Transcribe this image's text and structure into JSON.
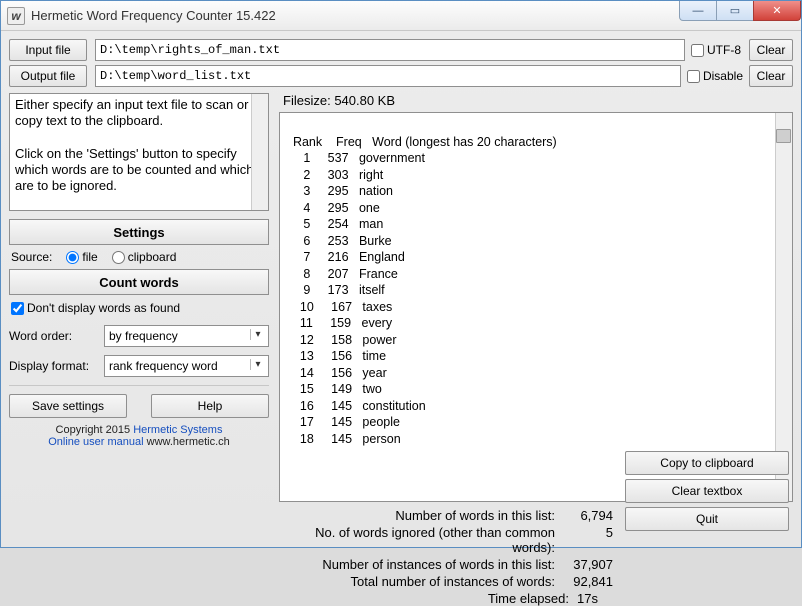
{
  "window": {
    "title": "Hermetic Word Frequency Counter 15.422"
  },
  "io": {
    "input_btn": "Input file",
    "output_btn": "Output file",
    "input_path": "D:\\temp\\rights_of_man.txt",
    "output_path": "D:\\temp\\word_list.txt",
    "utf8_label": "UTF-8",
    "disable_label": "Disable",
    "clear_label": "Clear"
  },
  "info": {
    "text1": "Either specify an input text file to scan or copy text to the clipboard.",
    "text2": "Click on the 'Settings' button to specify which words are to be counted and which are to be ignored."
  },
  "left": {
    "settings_btn": "Settings",
    "source_label": "Source:",
    "source_file": "file",
    "source_clip": "clipboard",
    "count_btn": "Count words",
    "dont_display": "Don't display words as found",
    "word_order_label": "Word order:",
    "word_order_value": "by frequency",
    "display_format_label": "Display format:",
    "display_format_value": "rank frequency word",
    "save_settings": "Save settings",
    "help": "Help",
    "copyright": "Copyright 2015",
    "hermetic": "Hermetic Systems",
    "manual": "Online user manual",
    "site": "www.hermetic.ch"
  },
  "results": {
    "filesize_label": "Filesize:",
    "filesize_value": "540.80 KB",
    "header": "  Rank    Freq   Word (longest has 20 characters)",
    "rows": [
      {
        "rank": 1,
        "freq": 537,
        "word": "government"
      },
      {
        "rank": 2,
        "freq": 303,
        "word": "right"
      },
      {
        "rank": 3,
        "freq": 295,
        "word": "nation"
      },
      {
        "rank": 4,
        "freq": 295,
        "word": "one"
      },
      {
        "rank": 5,
        "freq": 254,
        "word": "man"
      },
      {
        "rank": 6,
        "freq": 253,
        "word": "Burke"
      },
      {
        "rank": 7,
        "freq": 216,
        "word": "England"
      },
      {
        "rank": 8,
        "freq": 207,
        "word": "France"
      },
      {
        "rank": 9,
        "freq": 173,
        "word": "itself"
      },
      {
        "rank": 10,
        "freq": 167,
        "word": "taxes"
      },
      {
        "rank": 11,
        "freq": 159,
        "word": "every"
      },
      {
        "rank": 12,
        "freq": 158,
        "word": "power"
      },
      {
        "rank": 13,
        "freq": 156,
        "word": "time"
      },
      {
        "rank": 14,
        "freq": 156,
        "word": "year"
      },
      {
        "rank": 15,
        "freq": 149,
        "word": "two"
      },
      {
        "rank": 16,
        "freq": 145,
        "word": "constitution"
      },
      {
        "rank": 17,
        "freq": 145,
        "word": "people"
      },
      {
        "rank": 18,
        "freq": 145,
        "word": "person"
      }
    ]
  },
  "stats": {
    "num_words_label": "Number of words in this list:",
    "num_words_value": "6,794",
    "ignored_label": "No. of words ignored (other than common words):",
    "ignored_value": "5",
    "instances_list_label": "Number of instances of words in this list:",
    "instances_list_value": "37,907",
    "total_instances_label": "Total number of instances of words:",
    "total_instances_value": "92,841",
    "elapsed_label": "Time elapsed:",
    "elapsed_value": "17s"
  },
  "right_buttons": {
    "copy": "Copy to clipboard",
    "clear_tb": "Clear textbox",
    "quit": "Quit"
  }
}
